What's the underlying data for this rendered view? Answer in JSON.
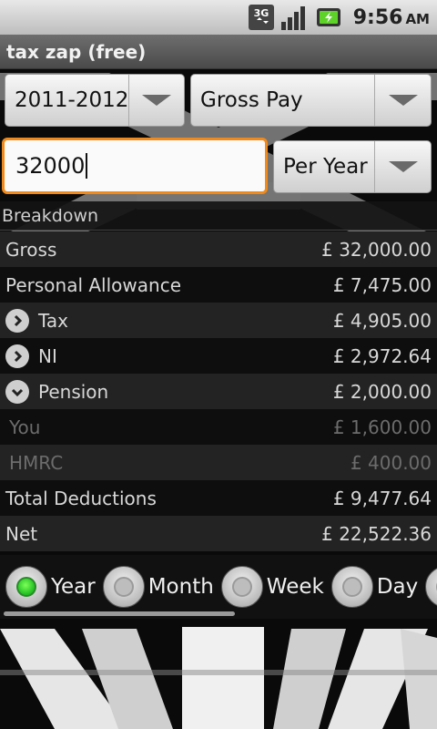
{
  "status_bar": {
    "network_label": "3G",
    "time": "9:56",
    "ampm": "AM",
    "icons": [
      "3g-data-icon",
      "signal-strength-icon",
      "battery-charging-icon"
    ]
  },
  "app": {
    "title": "tax zap (free)"
  },
  "controls": {
    "year_spinner": "2011-2012",
    "pay_type_spinner": "Gross Pay",
    "amount_input": "32000",
    "period_spinner": "Per Year"
  },
  "breakdown": {
    "header": "Breakdown",
    "rows": [
      {
        "label": "Gross",
        "value": "£ 32,000.00"
      },
      {
        "label": "Personal Allowance",
        "value": "£ 7,475.00"
      },
      {
        "label": "Tax",
        "value": "£ 4,905.00",
        "expander": "chevron-right-icon"
      },
      {
        "label": "NI",
        "value": "£ 2,972.64",
        "expander": "chevron-right-icon"
      },
      {
        "label": "Pension",
        "value": "£ 2,000.00",
        "expander": "chevron-down-icon"
      },
      {
        "label": "You",
        "value": "£ 1,600.00"
      },
      {
        "label": "HMRC",
        "value": "£ 400.00"
      },
      {
        "label": "Total Deductions",
        "value": "£ 9,477.64"
      },
      {
        "label": "Net",
        "value": "£ 22,522.36"
      }
    ]
  },
  "period_selector": {
    "options": [
      "Year",
      "Month",
      "Week",
      "Day"
    ],
    "selected": "Year"
  },
  "colors": {
    "input_focus_border": "#f08a1c",
    "radio_selected": "#1fbf1f"
  }
}
